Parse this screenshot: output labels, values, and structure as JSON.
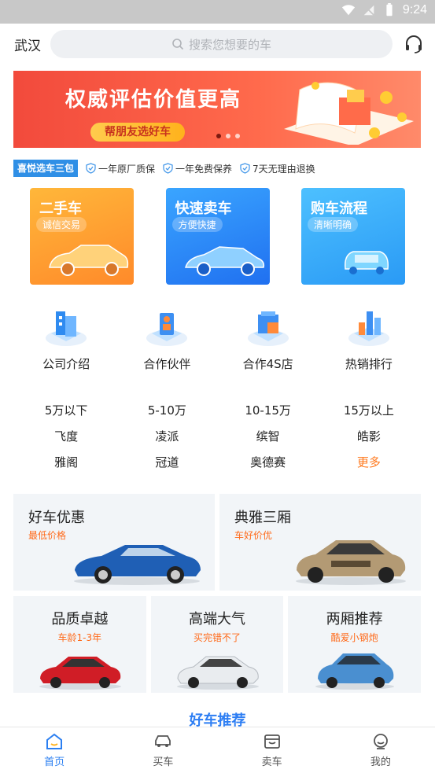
{
  "status_bar": {
    "time": "9:24"
  },
  "header": {
    "city": "武汉",
    "search_placeholder": "搜索您想要的车"
  },
  "banner": {
    "title": "权威评估价值更高",
    "button": "帮朋友选好车",
    "slides_total": 3,
    "slide_active": 1
  },
  "guarantee": {
    "badge": "喜悦选车三包",
    "items": [
      "一年原厂质保",
      "一年免费保养",
      "7天无理由退换"
    ]
  },
  "big_cards": [
    {
      "title": "二手车",
      "subtitle": "诚信交易"
    },
    {
      "title": "快速卖车",
      "subtitle": "方便快捷"
    },
    {
      "title": "购车流程",
      "subtitle": "清晰明确"
    }
  ],
  "quick_links": [
    "公司介绍",
    "合作伙伴",
    "合作4S店",
    "热销排行"
  ],
  "price_grid": [
    [
      "5万以下",
      "5-10万",
      "10-15万",
      "15万以上"
    ],
    [
      "飞度",
      "凌派",
      "缤智",
      "皓影"
    ],
    [
      "雅阁",
      "冠道",
      "奥德赛",
      "更多"
    ]
  ],
  "promos_top": [
    {
      "title": "好车优惠",
      "subtitle": "最低价格"
    },
    {
      "title": "典雅三厢",
      "subtitle": "车好价优"
    }
  ],
  "promos_bottom": [
    {
      "title": "品质卓越",
      "subtitle": "车龄1-3年"
    },
    {
      "title": "高端大气",
      "subtitle": "买完错不了"
    },
    {
      "title": "两厢推荐",
      "subtitle": "酷爱小钢炮"
    }
  ],
  "section_title": "好车推荐",
  "tabbar": [
    {
      "label": "首页",
      "active": true
    },
    {
      "label": "买车",
      "active": false
    },
    {
      "label": "卖车",
      "active": false
    },
    {
      "label": "我的",
      "active": false
    }
  ],
  "colors": {
    "accent": "#2b7ff1",
    "orange": "#ff7a1f",
    "banner_red": "#f24a3c"
  }
}
